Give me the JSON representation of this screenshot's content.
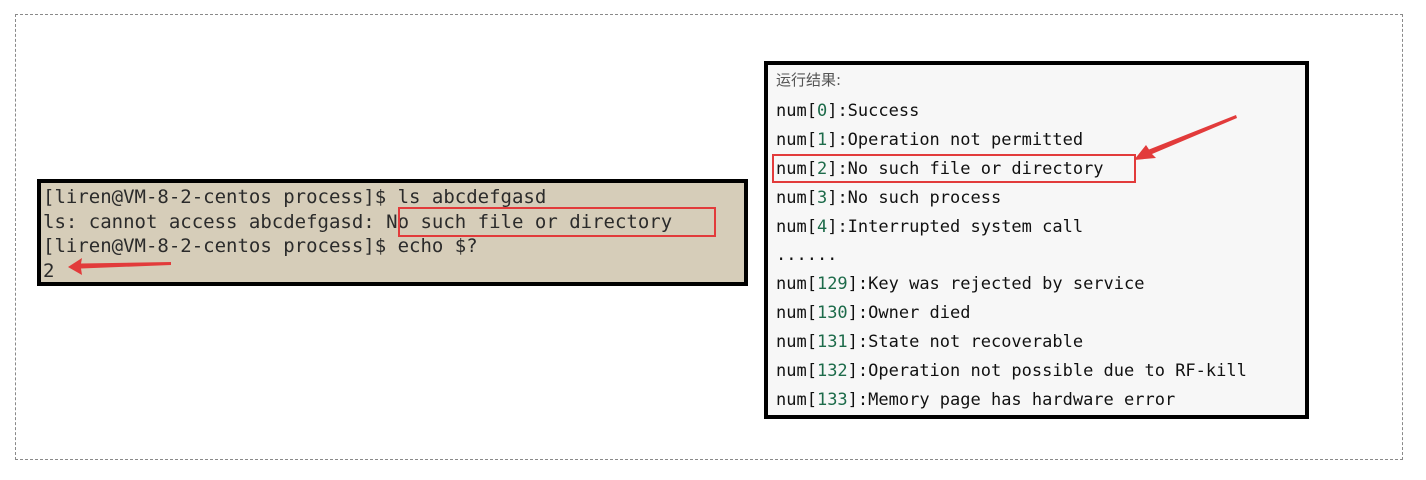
{
  "terminal": {
    "lines": [
      "[liren@VM-8-2-centos process]$ ls abcdefgasd",
      "ls: cannot access abcdefgasd: No such file or directory",
      "[liren@VM-8-2-centos process]$ echo $?",
      "2"
    ]
  },
  "result": {
    "title": "运行结果:",
    "rows": [
      {
        "prefix": "num[",
        "index": "0",
        "suffix": "]:Success"
      },
      {
        "prefix": "num[",
        "index": "1",
        "suffix": "]:Operation not permitted"
      },
      {
        "prefix": "num[",
        "index": "2",
        "suffix": "]:No such file or directory"
      },
      {
        "prefix": "num[",
        "index": "3",
        "suffix": "]:No such process"
      },
      {
        "prefix": "num[",
        "index": "4",
        "suffix": "]:Interrupted system call"
      },
      {
        "ellipsis": "......"
      },
      {
        "prefix": "num[",
        "index": "129",
        "suffix": "]:Key was rejected by service"
      },
      {
        "prefix": "num[",
        "index": "130",
        "suffix": "]:Owner died"
      },
      {
        "prefix": "num[",
        "index": "131",
        "suffix": "]:State not recoverable"
      },
      {
        "prefix": "num[",
        "index": "132",
        "suffix": "]:Operation not possible due to RF-kill"
      },
      {
        "prefix": "num[",
        "index": "133",
        "suffix": "]:Memory page has hardware error"
      }
    ]
  },
  "colors": {
    "highlight": "#e23b3b",
    "terminal_bg": "#d6cdb9",
    "result_bg": "#f7f7f7",
    "index_color": "#1d6b4a"
  }
}
